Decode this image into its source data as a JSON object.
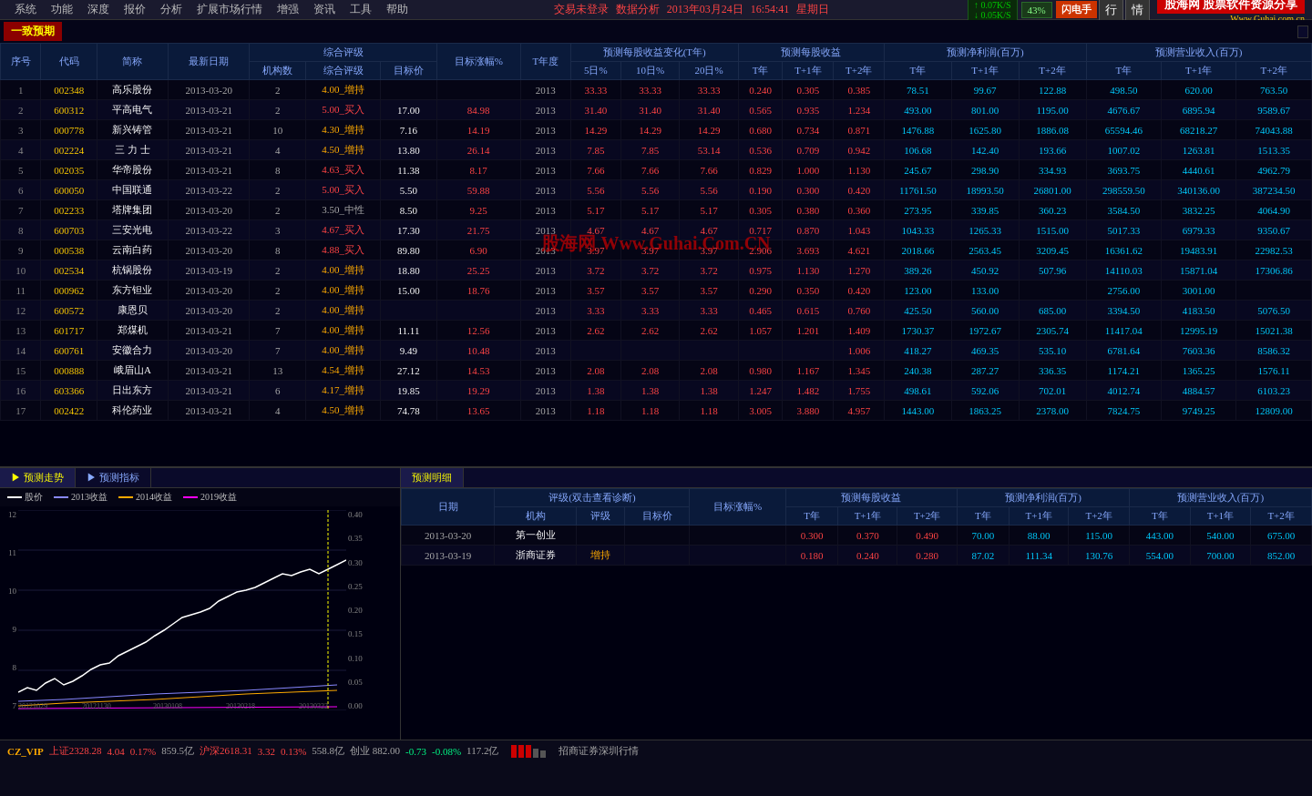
{
  "app": {
    "title": "股海网 股票软件资源分享",
    "url": "Www.Guhai.com.cn",
    "status": "交易未登录",
    "dataType": "数据分析",
    "date": "2013年03月24日",
    "time": "16:54:41",
    "weekday": "星期日"
  },
  "menu": {
    "items": [
      "系统",
      "功能",
      "深度",
      "报价",
      "分析",
      "扩展市场行情",
      "增强",
      "资讯",
      "工具",
      "帮助"
    ]
  },
  "speed": {
    "up": "0.07K/S",
    "down": "0.05K/S",
    "percent": "43%"
  },
  "buttons": {
    "flash": "闪电手",
    "row": "行",
    "emotion": "情"
  },
  "sectionLabel": "一致预期",
  "tableHeaders": {
    "num": "序号",
    "code": "代码",
    "name": "简称",
    "date": "最新日期",
    "ratingGroup": "综合评级",
    "sub": {
      "machineCount": "机构数",
      "rating": "综合评级",
      "targetPrice": "目标价"
    },
    "targetChange": "目标涨幅%",
    "yearDegree": "T年度",
    "forecastEPS": "预测每股收益变化(T年)",
    "epsSub": [
      "5日%",
      "10日%",
      "20日%"
    ],
    "forecastEPSMain": "预测每股收益",
    "epsMainSub": [
      "T年",
      "T+1年",
      "T+2年"
    ],
    "forecastProfit": "预测净利润(百万)",
    "profitSub": [
      "T年",
      "T+1年",
      "T+2年"
    ],
    "forecastRevenue": "预测营业收入(百万)",
    "revenueSub": [
      "T年",
      "T+1年",
      "T+2年"
    ]
  },
  "tableRows": [
    {
      "num": "1",
      "code": "002348",
      "name": "高乐股份",
      "date": "2013-03-20",
      "machines": 2,
      "rating": "4.00_增持",
      "targetPrice": "",
      "change": "",
      "year": "2013",
      "d5": "33.33",
      "d10": "33.33",
      "d20": "33.33",
      "tYear": "0.240",
      "t1Year": "0.305",
      "t2Year": "0.385",
      "profit_t": "78.51",
      "profit_t1": "99.67",
      "profit_t2": "122.88",
      "rev_t": "498.50",
      "rev_t1": "620.00",
      "rev_t2": "763.50"
    },
    {
      "num": "2",
      "code": "600312",
      "name": "平高电气",
      "date": "2013-03-21",
      "machines": 2,
      "rating": "5.00_买入",
      "targetPrice": "17.00",
      "change": "84.98",
      "year": "2013",
      "d5": "31.40",
      "d10": "31.40",
      "d20": "31.40",
      "tYear": "0.565",
      "t1Year": "0.935",
      "t2Year": "1.234",
      "profit_t": "493.00",
      "profit_t1": "801.00",
      "profit_t2": "1195.00",
      "rev_t": "4676.67",
      "rev_t1": "6895.94",
      "rev_t2": "9589.67"
    },
    {
      "num": "3",
      "code": "000778",
      "name": "新兴铸管",
      "date": "2013-03-21",
      "machines": 10,
      "rating": "4.30_增持",
      "targetPrice": "7.16",
      "change": "14.19",
      "year": "2013",
      "d5": "14.29",
      "d10": "14.29",
      "d20": "14.29",
      "tYear": "0.680",
      "t1Year": "0.734",
      "t2Year": "0.871",
      "profit_t": "1476.88",
      "profit_t1": "1625.80",
      "profit_t2": "1886.08",
      "rev_t": "65594.46",
      "rev_t1": "68218.27",
      "rev_t2": "74043.88"
    },
    {
      "num": "4",
      "code": "002224",
      "name": "三 力 士",
      "date": "2013-03-21",
      "machines": 4,
      "rating": "4.50_增持",
      "targetPrice": "13.80",
      "change": "26.14",
      "year": "2013",
      "d5": "7.85",
      "d10": "7.85",
      "d20": "53.14",
      "tYear": "0.536",
      "t1Year": "0.709",
      "t2Year": "0.942",
      "profit_t": "106.68",
      "profit_t1": "142.40",
      "profit_t2": "193.66",
      "rev_t": "1007.02",
      "rev_t1": "1263.81",
      "rev_t2": "1513.35"
    },
    {
      "num": "5",
      "code": "002035",
      "name": "华帝股份",
      "date": "2013-03-21",
      "machines": 8,
      "rating": "4.63_买入",
      "targetPrice": "11.38",
      "change": "8.17",
      "year": "2013",
      "d5": "7.66",
      "d10": "7.66",
      "d20": "7.66",
      "tYear": "0.829",
      "t1Year": "1.000",
      "t2Year": "1.130",
      "profit_t": "245.67",
      "profit_t1": "298.90",
      "profit_t2": "334.93",
      "rev_t": "3693.75",
      "rev_t1": "4440.61",
      "rev_t2": "4962.79"
    },
    {
      "num": "6",
      "code": "600050",
      "name": "中国联通",
      "date": "2013-03-22",
      "machines": 2,
      "rating": "5.00_买入",
      "targetPrice": "5.50",
      "change": "59.88",
      "year": "2013",
      "d5": "5.56",
      "d10": "5.56",
      "d20": "5.56",
      "tYear": "0.190",
      "t1Year": "0.300",
      "t2Year": "0.420",
      "profit_t": "11761.50",
      "profit_t1": "18993.50",
      "profit_t2": "26801.00",
      "rev_t": "298559.50",
      "rev_t1": "340136.00",
      "rev_t2": "387234.50"
    },
    {
      "num": "7",
      "code": "002233",
      "name": "塔牌集团",
      "date": "2013-03-20",
      "machines": 2,
      "rating": "3.50_中性",
      "targetPrice": "8.50",
      "change": "9.25",
      "year": "2013",
      "d5": "5.17",
      "d10": "5.17",
      "d20": "5.17",
      "tYear": "0.305",
      "t1Year": "0.380",
      "t2Year": "0.360",
      "profit_t": "273.95",
      "profit_t1": "339.85",
      "profit_t2": "360.23",
      "rev_t": "3584.50",
      "rev_t1": "3832.25",
      "rev_t2": "4064.90"
    },
    {
      "num": "8",
      "code": "600703",
      "name": "三安光电",
      "date": "2013-03-22",
      "machines": 3,
      "rating": "4.67_买入",
      "targetPrice": "17.30",
      "change": "21.75",
      "year": "2013",
      "d5": "4.67",
      "d10": "4.67",
      "d20": "4.67",
      "tYear": "0.717",
      "t1Year": "0.870",
      "t2Year": "1.043",
      "profit_t": "1043.33",
      "profit_t1": "1265.33",
      "profit_t2": "1515.00",
      "rev_t": "5017.33",
      "rev_t1": "6979.33",
      "rev_t2": "9350.67"
    },
    {
      "num": "9",
      "code": "000538",
      "name": "云南白药",
      "date": "2013-03-20",
      "machines": 8,
      "rating": "4.88_买入",
      "targetPrice": "89.80",
      "change": "6.90",
      "year": "2013",
      "d5": "3.97",
      "d10": "3.97",
      "d20": "3.97",
      "tYear": "2.906",
      "t1Year": "3.693",
      "t2Year": "4.621",
      "profit_t": "2018.66",
      "profit_t1": "2563.45",
      "profit_t2": "3209.45",
      "rev_t": "16361.62",
      "rev_t1": "19483.91",
      "rev_t2": "22982.53"
    },
    {
      "num": "10",
      "code": "002534",
      "name": "杭锅股份",
      "date": "2013-03-19",
      "machines": 2,
      "rating": "4.00_增持",
      "targetPrice": "18.80",
      "change": "25.25",
      "year": "2013",
      "d5": "3.72",
      "d10": "3.72",
      "d20": "3.72",
      "tYear": "0.975",
      "t1Year": "1.130",
      "t2Year": "1.270",
      "profit_t": "389.26",
      "profit_t1": "450.92",
      "profit_t2": "507.96",
      "rev_t": "14110.03",
      "rev_t1": "15871.04",
      "rev_t2": "17306.86"
    },
    {
      "num": "11",
      "code": "000962",
      "name": "东方钽业",
      "date": "2013-03-20",
      "machines": 2,
      "rating": "4.00_增持",
      "targetPrice": "15.00",
      "change": "18.76",
      "year": "2013",
      "d5": "3.57",
      "d10": "3.57",
      "d20": "3.57",
      "tYear": "0.290",
      "t1Year": "0.350",
      "t2Year": "0.420",
      "profit_t": "123.00",
      "profit_t1": "133.00",
      "profit_t2": "",
      "rev_t": "2756.00",
      "rev_t1": "3001.00",
      "rev_t2": ""
    },
    {
      "num": "12",
      "code": "600572",
      "name": "康恩贝",
      "date": "2013-03-20",
      "machines": 2,
      "rating": "4.00_增持",
      "targetPrice": "",
      "change": "",
      "year": "2013",
      "d5": "3.33",
      "d10": "3.33",
      "d20": "3.33",
      "tYear": "0.465",
      "t1Year": "0.615",
      "t2Year": "0.760",
      "profit_t": "425.50",
      "profit_t1": "560.00",
      "profit_t2": "685.00",
      "rev_t": "3394.50",
      "rev_t1": "4183.50",
      "rev_t2": "5076.50"
    },
    {
      "num": "13",
      "code": "601717",
      "name": "郑煤机",
      "date": "2013-03-21",
      "machines": 7,
      "rating": "4.00_增持",
      "targetPrice": "11.11",
      "change": "12.56",
      "year": "2013",
      "d5": "2.62",
      "d10": "2.62",
      "d20": "2.62",
      "tYear": "1.057",
      "t1Year": "1.201",
      "t2Year": "1.409",
      "profit_t": "1730.37",
      "profit_t1": "1972.67",
      "profit_t2": "2305.74",
      "rev_t": "11417.04",
      "rev_t1": "12995.19",
      "rev_t2": "15021.38"
    },
    {
      "num": "14",
      "code": "600761",
      "name": "安徽合力",
      "date": "2013-03-20",
      "machines": 7,
      "rating": "4.00_增持",
      "targetPrice": "9.49",
      "change": "10.48",
      "year": "2013",
      "d5": "",
      "d10": "",
      "d20": "",
      "tYear": "",
      "t1Year": "",
      "t2Year": "1.006",
      "profit_t": "418.27",
      "profit_t1": "469.35",
      "profit_t2": "535.10",
      "rev_t": "6781.64",
      "rev_t1": "7603.36",
      "rev_t2": "8586.32"
    },
    {
      "num": "15",
      "code": "000888",
      "name": "峨眉山A",
      "date": "2013-03-21",
      "machines": 13,
      "rating": "4.54_增持",
      "targetPrice": "27.12",
      "change": "14.53",
      "year": "2013",
      "d5": "2.08",
      "d10": "2.08",
      "d20": "2.08",
      "tYear": "0.980",
      "t1Year": "1.167",
      "t2Year": "1.345",
      "profit_t": "240.38",
      "profit_t1": "287.27",
      "profit_t2": "336.35",
      "rev_t": "1174.21",
      "rev_t1": "1365.25",
      "rev_t2": "1576.11"
    },
    {
      "num": "16",
      "code": "603366",
      "name": "日出东方",
      "date": "2013-03-21",
      "machines": 6,
      "rating": "4.17_增持",
      "targetPrice": "19.85",
      "change": "19.29",
      "year": "2013",
      "d5": "1.38",
      "d10": "1.38",
      "d20": "1.38",
      "tYear": "1.247",
      "t1Year": "1.482",
      "t2Year": "1.755",
      "profit_t": "498.61",
      "profit_t1": "592.06",
      "profit_t2": "702.01",
      "rev_t": "4012.74",
      "rev_t1": "4884.57",
      "rev_t2": "6103.23"
    },
    {
      "num": "17",
      "code": "002422",
      "name": "科伦药业",
      "date": "2013-03-21",
      "machines": 4,
      "rating": "4.50_增持",
      "targetPrice": "74.78",
      "change": "13.65",
      "year": "2013",
      "d5": "1.18",
      "d10": "1.18",
      "d20": "1.18",
      "tYear": "3.005",
      "t1Year": "3.880",
      "t2Year": "4.957",
      "profit_t": "1443.00",
      "profit_t1": "1863.25",
      "profit_t2": "2378.00",
      "rev_t": "7824.75",
      "rev_t1": "9749.25",
      "rev_t2": "12809.00"
    }
  ],
  "bottomTabs": {
    "left": [
      "预测走势",
      "预测指标"
    ],
    "right": [
      "预测明细"
    ]
  },
  "chart": {
    "legend": [
      "股价",
      "2013收益",
      "2014收益",
      "2019收益"
    ],
    "colors": [
      "#ffffff",
      "#8888ff",
      "#ffaa00",
      "#ff00ff"
    ],
    "yLabels": [
      "12",
      "11",
      "10",
      "9",
      "8",
      "7"
    ],
    "yRight": [
      "0.40",
      "0.35",
      "0.30",
      "0.25",
      "0.20",
      "0.15",
      "0.10",
      "0.05",
      "0.00"
    ],
    "xLabels": [
      "20121029",
      "20121130",
      "20130108",
      "20130218",
      "20130322"
    ]
  },
  "detailTable": {
    "headers": {
      "date": "日期",
      "ratingGroup": "评级(双击查看诊断)",
      "sub": {
        "machine": "机构",
        "rating": "评级",
        "targetPrice": "目标价"
      },
      "targetChange": "目标涨幅%",
      "forecastEPS": "预测每股收益",
      "epsSub": [
        "T年",
        "T+1年",
        "T+2年"
      ],
      "forecastProfit": "预测净利润(百万)",
      "profitSub": [
        "T年",
        "T+1年",
        "T+2年"
      ],
      "forecastRevenue": "预测营业收入(百万)",
      "revenueSub": [
        "T年",
        "T+1年",
        "T+2年"
      ]
    },
    "rows": [
      {
        "date": "2013-03-20",
        "machine": "第一创业",
        "rating": "",
        "targetPrice": "",
        "change": "",
        "tYear": "0.300",
        "t1Year": "0.370",
        "t2Year": "0.490",
        "profit_t": "70.00",
        "profit_t1": "88.00",
        "profit_t2": "115.00",
        "rev_t": "443.00",
        "rev_t1": "540.00",
        "rev_t2": "675.00"
      },
      {
        "date": "2013-03-19",
        "machine": "浙商证券",
        "rating": "增持",
        "targetPrice": "",
        "change": "",
        "tYear": "0.180",
        "t1Year": "0.240",
        "t2Year": "0.280",
        "profit_t": "87.02",
        "profit_t1": "111.34",
        "profit_t2": "130.76",
        "rev_t": "554.00",
        "rev_t1": "700.00",
        "rev_t2": "852.00"
      }
    ]
  },
  "statusBar": {
    "vip": "CZ_VIP",
    "shIndex": "上证2328.28",
    "shChange": "4.04",
    "shChangePct": "0.17%",
    "shVol": "859.5亿",
    "szIndex": "沪深2618.31",
    "szChange": "3.32",
    "szChangePct": "0.13%",
    "cyIndex": "558.8亿",
    "gem": "创业 882.00",
    "gemChange": "-0.73",
    "gemChangePct": "-0.08%",
    "gemVol": "117.2亿",
    "broker": "招商证券深圳行情"
  },
  "watermark": "股海网 Www.Guhai.Com.CN"
}
